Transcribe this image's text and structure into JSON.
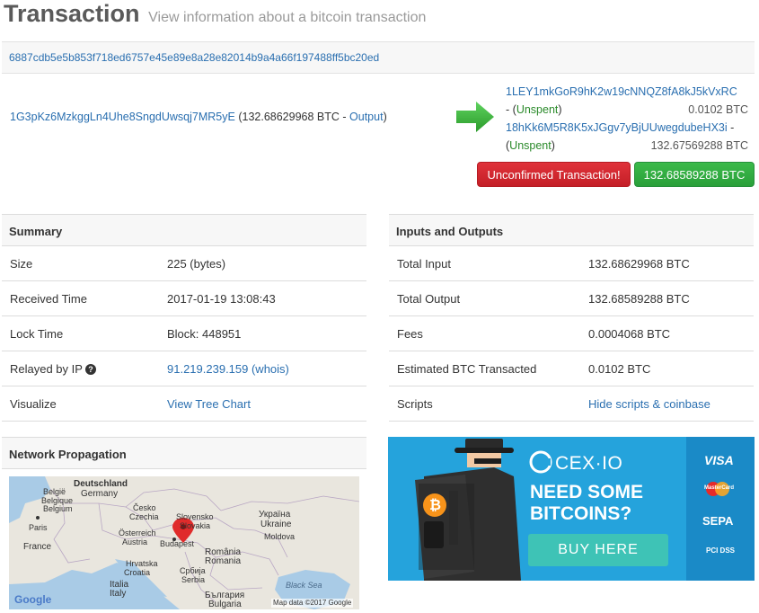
{
  "header": {
    "title": "Transaction",
    "subtitle": "View information about a bitcoin transaction"
  },
  "tx": {
    "hash": "6887cdb5e5b853f718ed6757e45e89e8a28e82014b9a4a66f197488ff5bc20ed",
    "input_address": "1G3pKz6MzkggLn4Uhe8SngdUwsqj7MR5yE",
    "input_amount": "(132.68629968 BTC - ",
    "input_output_link": "Output",
    "input_close": ")",
    "outputs": [
      {
        "address": "1LEY1mkGoR9hK2w19cNNQZ8fA8kJ5kVxRC",
        "prefix": "- (",
        "status": "Unspent",
        "suffix": ")",
        "amount": "0.0102 BTC"
      },
      {
        "address": "18hKk6M5R8K5xJGgv7yBjUUwegdubeHX3i",
        "dash": "-",
        "prefix": "(",
        "status": "Unspent",
        "suffix": ")",
        "amount": "132.67569288 BTC"
      }
    ],
    "unconfirmed_label": "Unconfirmed Transaction!",
    "total_label": "132.68589288 BTC"
  },
  "summary": {
    "heading": "Summary",
    "rows": [
      {
        "key": "Size",
        "value": "225 (bytes)"
      },
      {
        "key": "Received Time",
        "value": "2017-01-19 13:08:43"
      },
      {
        "key": "Lock Time",
        "value": "Block: 448951"
      },
      {
        "key": "Relayed by IP",
        "value": "91.219.239.159 (whois)"
      },
      {
        "key": "Visualize",
        "value": "View Tree Chart"
      }
    ],
    "help_glyph": "?"
  },
  "io": {
    "heading": "Inputs and Outputs",
    "rows": [
      {
        "key": "Total Input",
        "value": "132.68629968 BTC"
      },
      {
        "key": "Total Output",
        "value": "132.68589288 BTC"
      },
      {
        "key": "Fees",
        "value": "0.0004068 BTC"
      },
      {
        "key": "Estimated BTC Transacted",
        "value": "0.0102 BTC"
      },
      {
        "key": "Scripts",
        "value": "Hide scripts & coinbase"
      }
    ]
  },
  "network": {
    "heading": "Network Propagation",
    "map_labels": [
      "Deutschland",
      "Germany",
      "België",
      "Belgique",
      "Belgium",
      "Česko",
      "Czechia",
      "Slovensko",
      "Slovakia",
      "Україна",
      "Ukraine",
      "Paris",
      "France",
      "Österreich",
      "Austria",
      "Budapest",
      "Moldova",
      "Hrvatska",
      "Croatia",
      "România",
      "Romania",
      "Србија",
      "Serbia",
      "Black Sea",
      "Italia",
      "Italy",
      "България",
      "Bulgaria"
    ],
    "google": "Google",
    "map_credit": "Map data ©2017 Google",
    "colors": {
      "land": "#e9e6de",
      "water": "#a9cbe6",
      "marker": "#e02b2b"
    }
  },
  "ad": {
    "brand": "CEX·IO",
    "line1": "NEED SOME",
    "line2": "BITCOINS?",
    "cta": "BUY HERE",
    "payments": [
      "VISA",
      "MasterCard",
      "SEPA",
      "PCI DSS"
    ],
    "colors": {
      "bg": "#25a3dc",
      "cta": "#3ec3b6",
      "side": "#1a8ac7"
    }
  }
}
